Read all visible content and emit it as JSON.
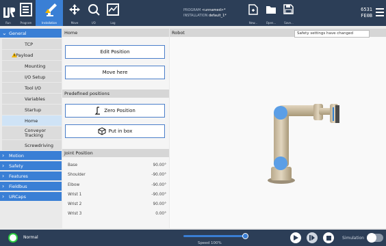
{
  "header": {
    "buttons": [
      {
        "id": "run",
        "label": "Run"
      },
      {
        "id": "program",
        "label": "Program"
      },
      {
        "id": "installation",
        "label": "Installation"
      },
      {
        "id": "move",
        "label": "Move"
      },
      {
        "id": "io",
        "label": "I/O"
      },
      {
        "id": "log",
        "label": "Log"
      }
    ],
    "program_label": "PROGRAM",
    "program_value": "<unnamed>*",
    "installation_label": "INSTALLATION",
    "installation_value": "default_1*",
    "file_buttons": [
      {
        "id": "new",
        "label": "New..."
      },
      {
        "id": "open",
        "label": "Open..."
      },
      {
        "id": "save",
        "label": "Save..."
      }
    ],
    "code_line1": "6531",
    "code_line2": "FE0B"
  },
  "nav": {
    "general_label": "General",
    "items": [
      {
        "label": "TCP"
      },
      {
        "label": "Payload",
        "warning": true
      },
      {
        "label": "Mounting"
      },
      {
        "label": "I/O Setup"
      },
      {
        "label": "Tool I/O"
      },
      {
        "label": "Variables"
      },
      {
        "label": "Startup"
      },
      {
        "label": "Home",
        "selected": true
      },
      {
        "label": "Conveyor Tracking"
      },
      {
        "label": "Screwdriving"
      }
    ],
    "categories": [
      {
        "label": "Motion"
      },
      {
        "label": "Safety"
      },
      {
        "label": "Features"
      },
      {
        "label": "Fieldbus"
      },
      {
        "label": "URCaps"
      }
    ]
  },
  "panel": {
    "title": "Home",
    "edit_position": "Edit Position",
    "move_here": "Move here",
    "predefined_title": "Predefined positions",
    "zero_position": "Zero Position",
    "put_in_box": "Put in box",
    "joint_title": "Joint Position",
    "joints": [
      {
        "name": "Base",
        "value": "90.00°"
      },
      {
        "name": "Shoulder",
        "value": "-90.00°"
      },
      {
        "name": "Elbow",
        "value": "-90.00°"
      },
      {
        "name": "Wrist 1",
        "value": "-90.00°"
      },
      {
        "name": "Wrist 2",
        "value": "90.00°"
      },
      {
        "name": "Wrist 3",
        "value": "0.00°"
      }
    ]
  },
  "robot": {
    "title": "Robot",
    "safety_message": "Safety settings have changed"
  },
  "footer": {
    "status": "Normal",
    "speed": "Speed 100%",
    "speed_fraction": 0.93,
    "simulation": "Simulation",
    "accent": "#3a7fd5",
    "status_color": "#2ecc40"
  }
}
